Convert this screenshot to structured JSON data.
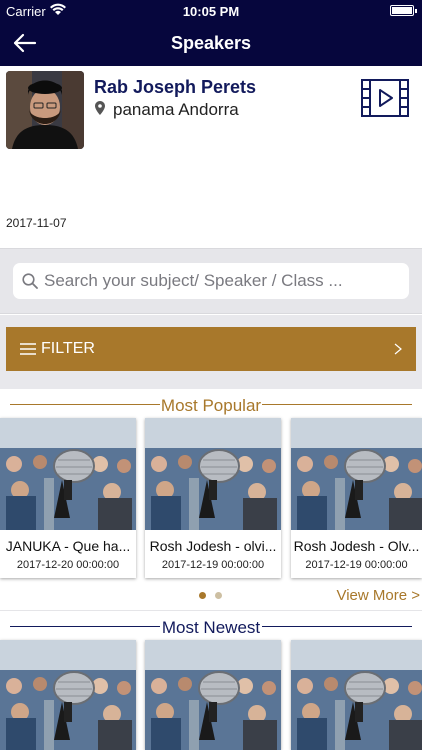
{
  "status_bar": {
    "carrier": "Carrier",
    "time": "10:05 PM"
  },
  "nav": {
    "title": "Speakers"
  },
  "speaker": {
    "name": "Rab Joseph Perets",
    "location": "panama Andorra",
    "date": "2017-11-07"
  },
  "search": {
    "placeholder": "Search your subject/ Speaker / Class ..."
  },
  "filter": {
    "label": "FILTER"
  },
  "most_popular": {
    "title": "Most Popular",
    "view_more": "View More >",
    "cards": [
      {
        "title": "JANUKA - Que ha...",
        "date": "2017-12-20 00:00:00"
      },
      {
        "title": "Rosh Jodesh - olvi...",
        "date": "2017-12-19 00:00:00"
      },
      {
        "title": "Rosh Jodesh - Olv...",
        "date": "2017-12-19 00:00:00"
      }
    ],
    "page_dots": {
      "count": 2,
      "active": 0
    }
  },
  "most_newest": {
    "title": "Most Newest",
    "cards": [
      {
        "title": "",
        "date": ""
      },
      {
        "title": "",
        "date": ""
      },
      {
        "title": "",
        "date": ""
      }
    ]
  },
  "colors": {
    "navbar": "#06063d",
    "accent_gold": "#a8782b",
    "speaker_name": "#121a5c",
    "search_bg": "#e6e6ea",
    "dot_active": "#a8782b",
    "dot_inactive": "#cdbfa2"
  },
  "icons": {
    "back": "back-arrow-icon",
    "location": "location-pin-icon",
    "video": "video-icon",
    "search": "search-icon",
    "menu": "menu-icon",
    "chevron": "chevron-right-icon"
  }
}
